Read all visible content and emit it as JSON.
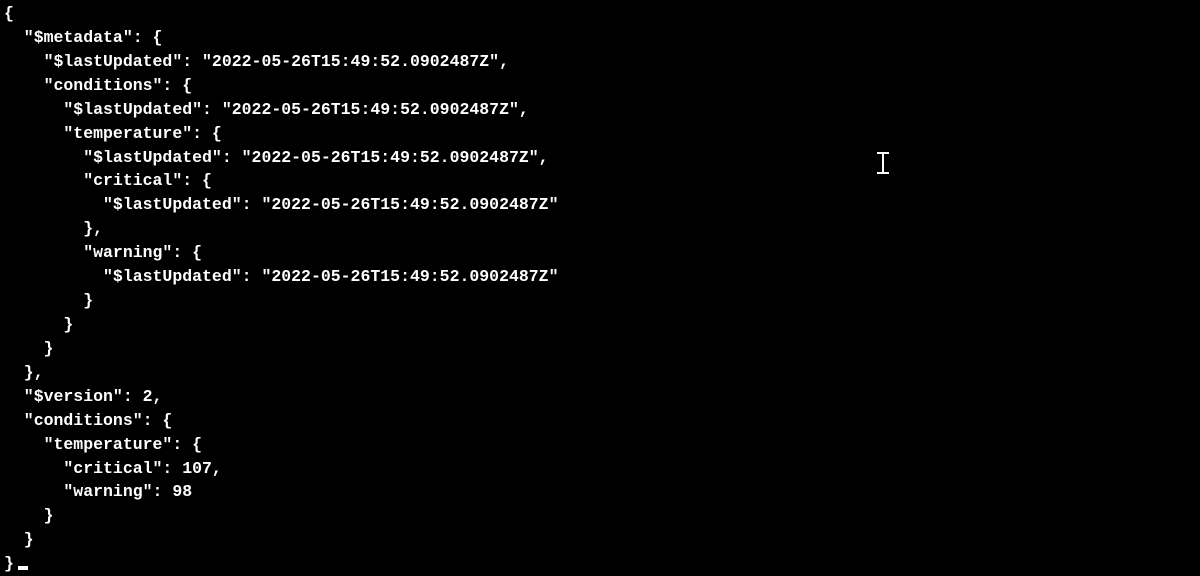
{
  "code": {
    "l01": "{",
    "l02": "  \"$metadata\": {",
    "l03": "    \"$lastUpdated\": \"2022-05-26T15:49:52.0902487Z\",",
    "l04": "    \"conditions\": {",
    "l05": "      \"$lastUpdated\": \"2022-05-26T15:49:52.0902487Z\",",
    "l06": "      \"temperature\": {",
    "l07": "        \"$lastUpdated\": \"2022-05-26T15:49:52.0902487Z\",",
    "l08": "        \"critical\": {",
    "l09": "          \"$lastUpdated\": \"2022-05-26T15:49:52.0902487Z\"",
    "l10": "        },",
    "l11": "        \"warning\": {",
    "l12": "          \"$lastUpdated\": \"2022-05-26T15:49:52.0902487Z\"",
    "l13": "        }",
    "l14": "      }",
    "l15": "    }",
    "l16": "  },",
    "l17": "  \"$version\": 2,",
    "l18": "  \"conditions\": {",
    "l19": "    \"temperature\": {",
    "l20": "      \"critical\": 107,",
    "l21": "      \"warning\": 98",
    "l22": "    }",
    "l23": "  }",
    "l24": "}"
  }
}
